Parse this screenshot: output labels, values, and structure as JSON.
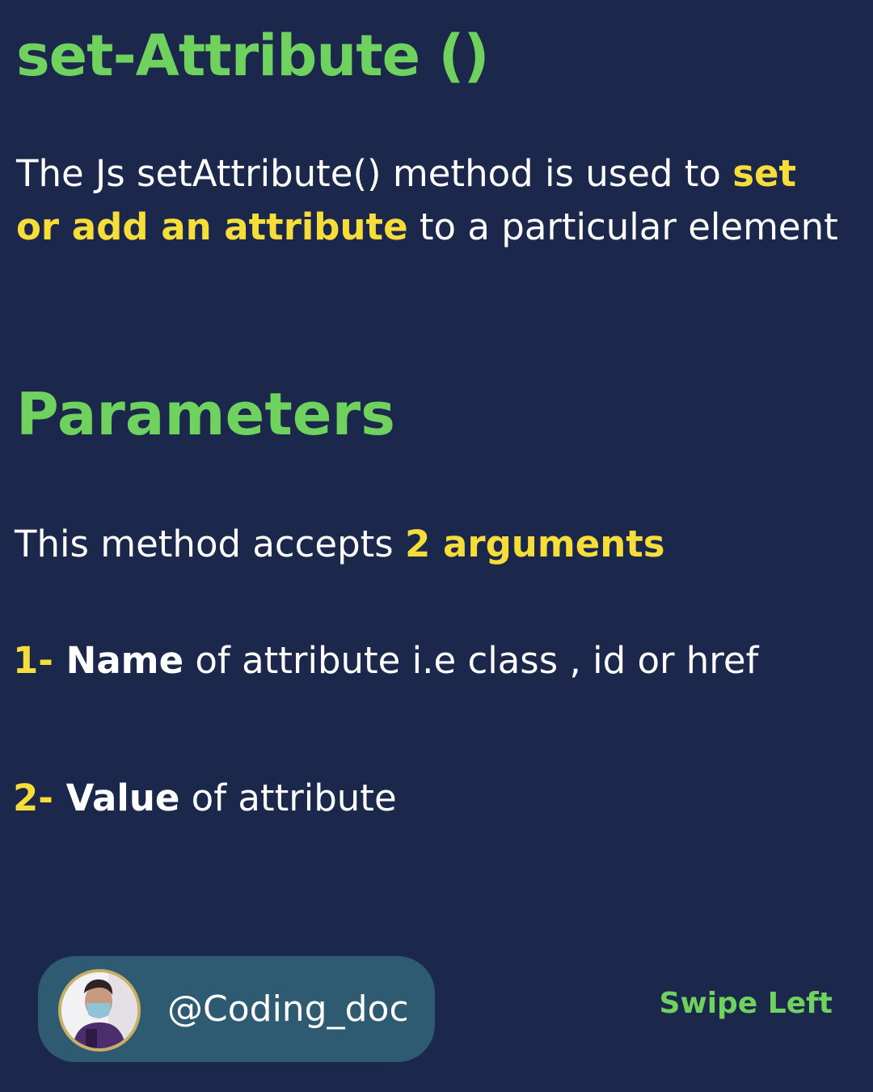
{
  "title": "set-Attribute ()",
  "intro": {
    "part1": "The Js setAttribute() method is used to ",
    "highlight": "set or add an attribute",
    "part2": " to a particular element"
  },
  "parameters": {
    "heading": "Parameters",
    "accepts_prefix": "This method accepts ",
    "accepts_highlight": "2 arguments",
    "items": [
      {
        "number": "1- ",
        "term": "Name",
        "description": " of attribute i.e class , id or href"
      },
      {
        "number": "2- ",
        "term": "Value",
        "description": " of attribute"
      }
    ]
  },
  "footer": {
    "handle": "@Coding_doc",
    "swipe": "Swipe Left"
  },
  "colors": {
    "background": "#1b274b",
    "heading_green": "#6fd15e",
    "highlight_yellow": "#f6dd3a",
    "pill": "#2e5a72"
  }
}
